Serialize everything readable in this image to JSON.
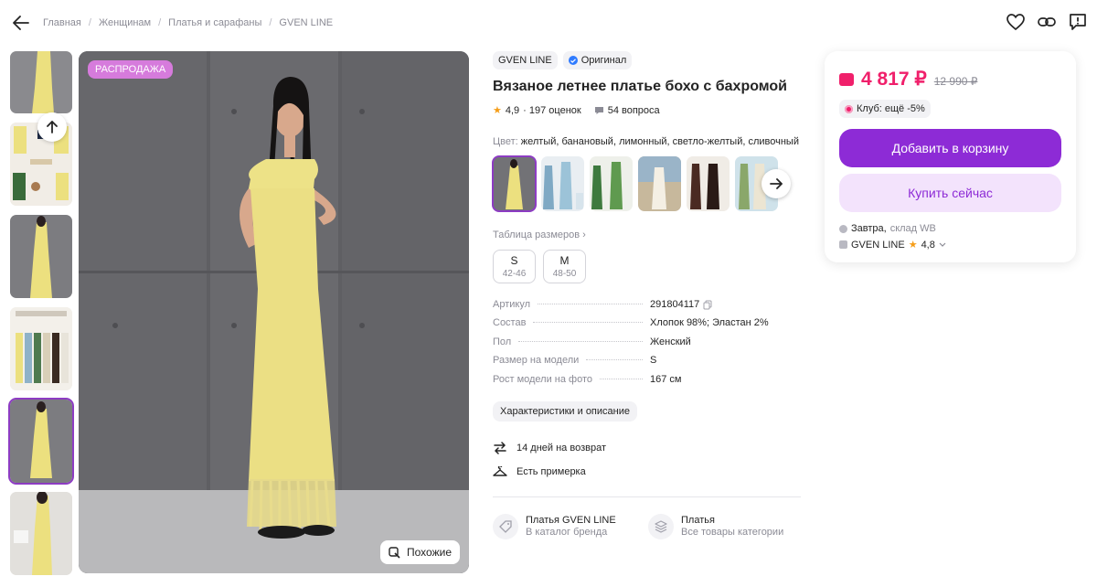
{
  "breadcrumbs": [
    "Главная",
    "Женщинам",
    "Платья и сарафаны",
    "GVEN LINE"
  ],
  "gallery": {
    "sale_badge": "РАСПРОДАЖА",
    "similar_label": "Похожие"
  },
  "product": {
    "brand": "GVEN LINE",
    "original_label": "Оригинал",
    "title": "Вязаное летнее платье бохо с бахромой",
    "rating": "4,9",
    "reviews": "· 197 оценок",
    "questions": "54 вопроса",
    "color_label": "Цвет:",
    "color_value": "желтый, банановый, лимонный, светло-желтый, сливочный",
    "size_table_label": "Таблица размеров ›",
    "sizes": [
      {
        "size": "S",
        "ru": "42-46"
      },
      {
        "size": "M",
        "ru": "48-50"
      }
    ],
    "specs": [
      {
        "key": "Артикул",
        "value": "291804117"
      },
      {
        "key": "Состав",
        "value": "Хлопок 98%; Эластан 2%"
      },
      {
        "key": "Пол",
        "value": "Женский"
      },
      {
        "key": "Размер на модели",
        "value": "S"
      },
      {
        "key": "Рост модели на фото",
        "value": "167 см"
      }
    ],
    "characteristics_label": "Характеристики и описание",
    "perks": [
      "14 дней на возврат",
      "Есть примерка"
    ],
    "links": [
      {
        "title": "Платья GVEN LINE",
        "subtitle": "В каталог бренда"
      },
      {
        "title": "Платья",
        "subtitle": "Все товары категории"
      }
    ]
  },
  "buy_card": {
    "price": "4 817 ₽",
    "old_price": "12 990 ₽",
    "club": "Клуб: ещё -5%",
    "add_to_cart": "Добавить в корзину",
    "buy_now": "Купить сейчас",
    "delivery_when": "Завтра,",
    "delivery_where": "склад WB",
    "seller": "GVEN LINE",
    "seller_rating": "4,8"
  },
  "colors": {
    "accent": "#8d2bd6",
    "price": "#f0206b",
    "dress": "#ece07f"
  }
}
